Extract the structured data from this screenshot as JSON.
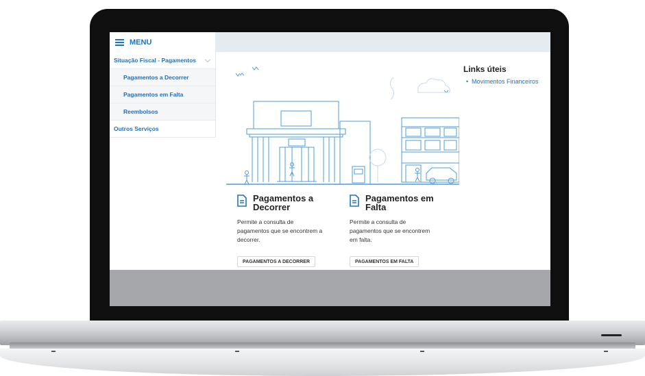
{
  "header": {
    "menu_label": "MENU"
  },
  "sidebar": {
    "items": [
      {
        "label": "Situação Fiscal - Pagamentos"
      },
      {
        "label": "Pagamentos a Decorrer"
      },
      {
        "label": "Pagamentos em Falta"
      },
      {
        "label": "Reembolsos"
      },
      {
        "label": "Outros Serviços"
      }
    ]
  },
  "links": {
    "title": "Links úteis",
    "items": [
      {
        "label": "Movimentos Financeiros"
      }
    ]
  },
  "cards": [
    {
      "title_line1": "Pagamentos a",
      "title_line2": "Decorrer",
      "desc_line1": "Permite a consulta de",
      "desc_line2": "pagamentos que se encontrem a",
      "desc_line3": "decorrer.",
      "button": "PAGAMENTOS A DECORRER"
    },
    {
      "title_line1": "Pagamentos em",
      "title_line2": "Falta",
      "desc_line1": "Permite a consulta de",
      "desc_line2": "pagamentos que se encontrem",
      "desc_line3": "em falta.",
      "button": "PAGAMENTOS EM FALTA"
    }
  ],
  "colors": {
    "accent": "#1f72c4",
    "illustration": "#4f9bd9",
    "topbar": "#e4ebf1",
    "footer_gray": "#a5a7aa"
  },
  "icons": {
    "menu": "hamburger-icon",
    "card": "document-icon",
    "expand": "chevron-down-icon"
  }
}
